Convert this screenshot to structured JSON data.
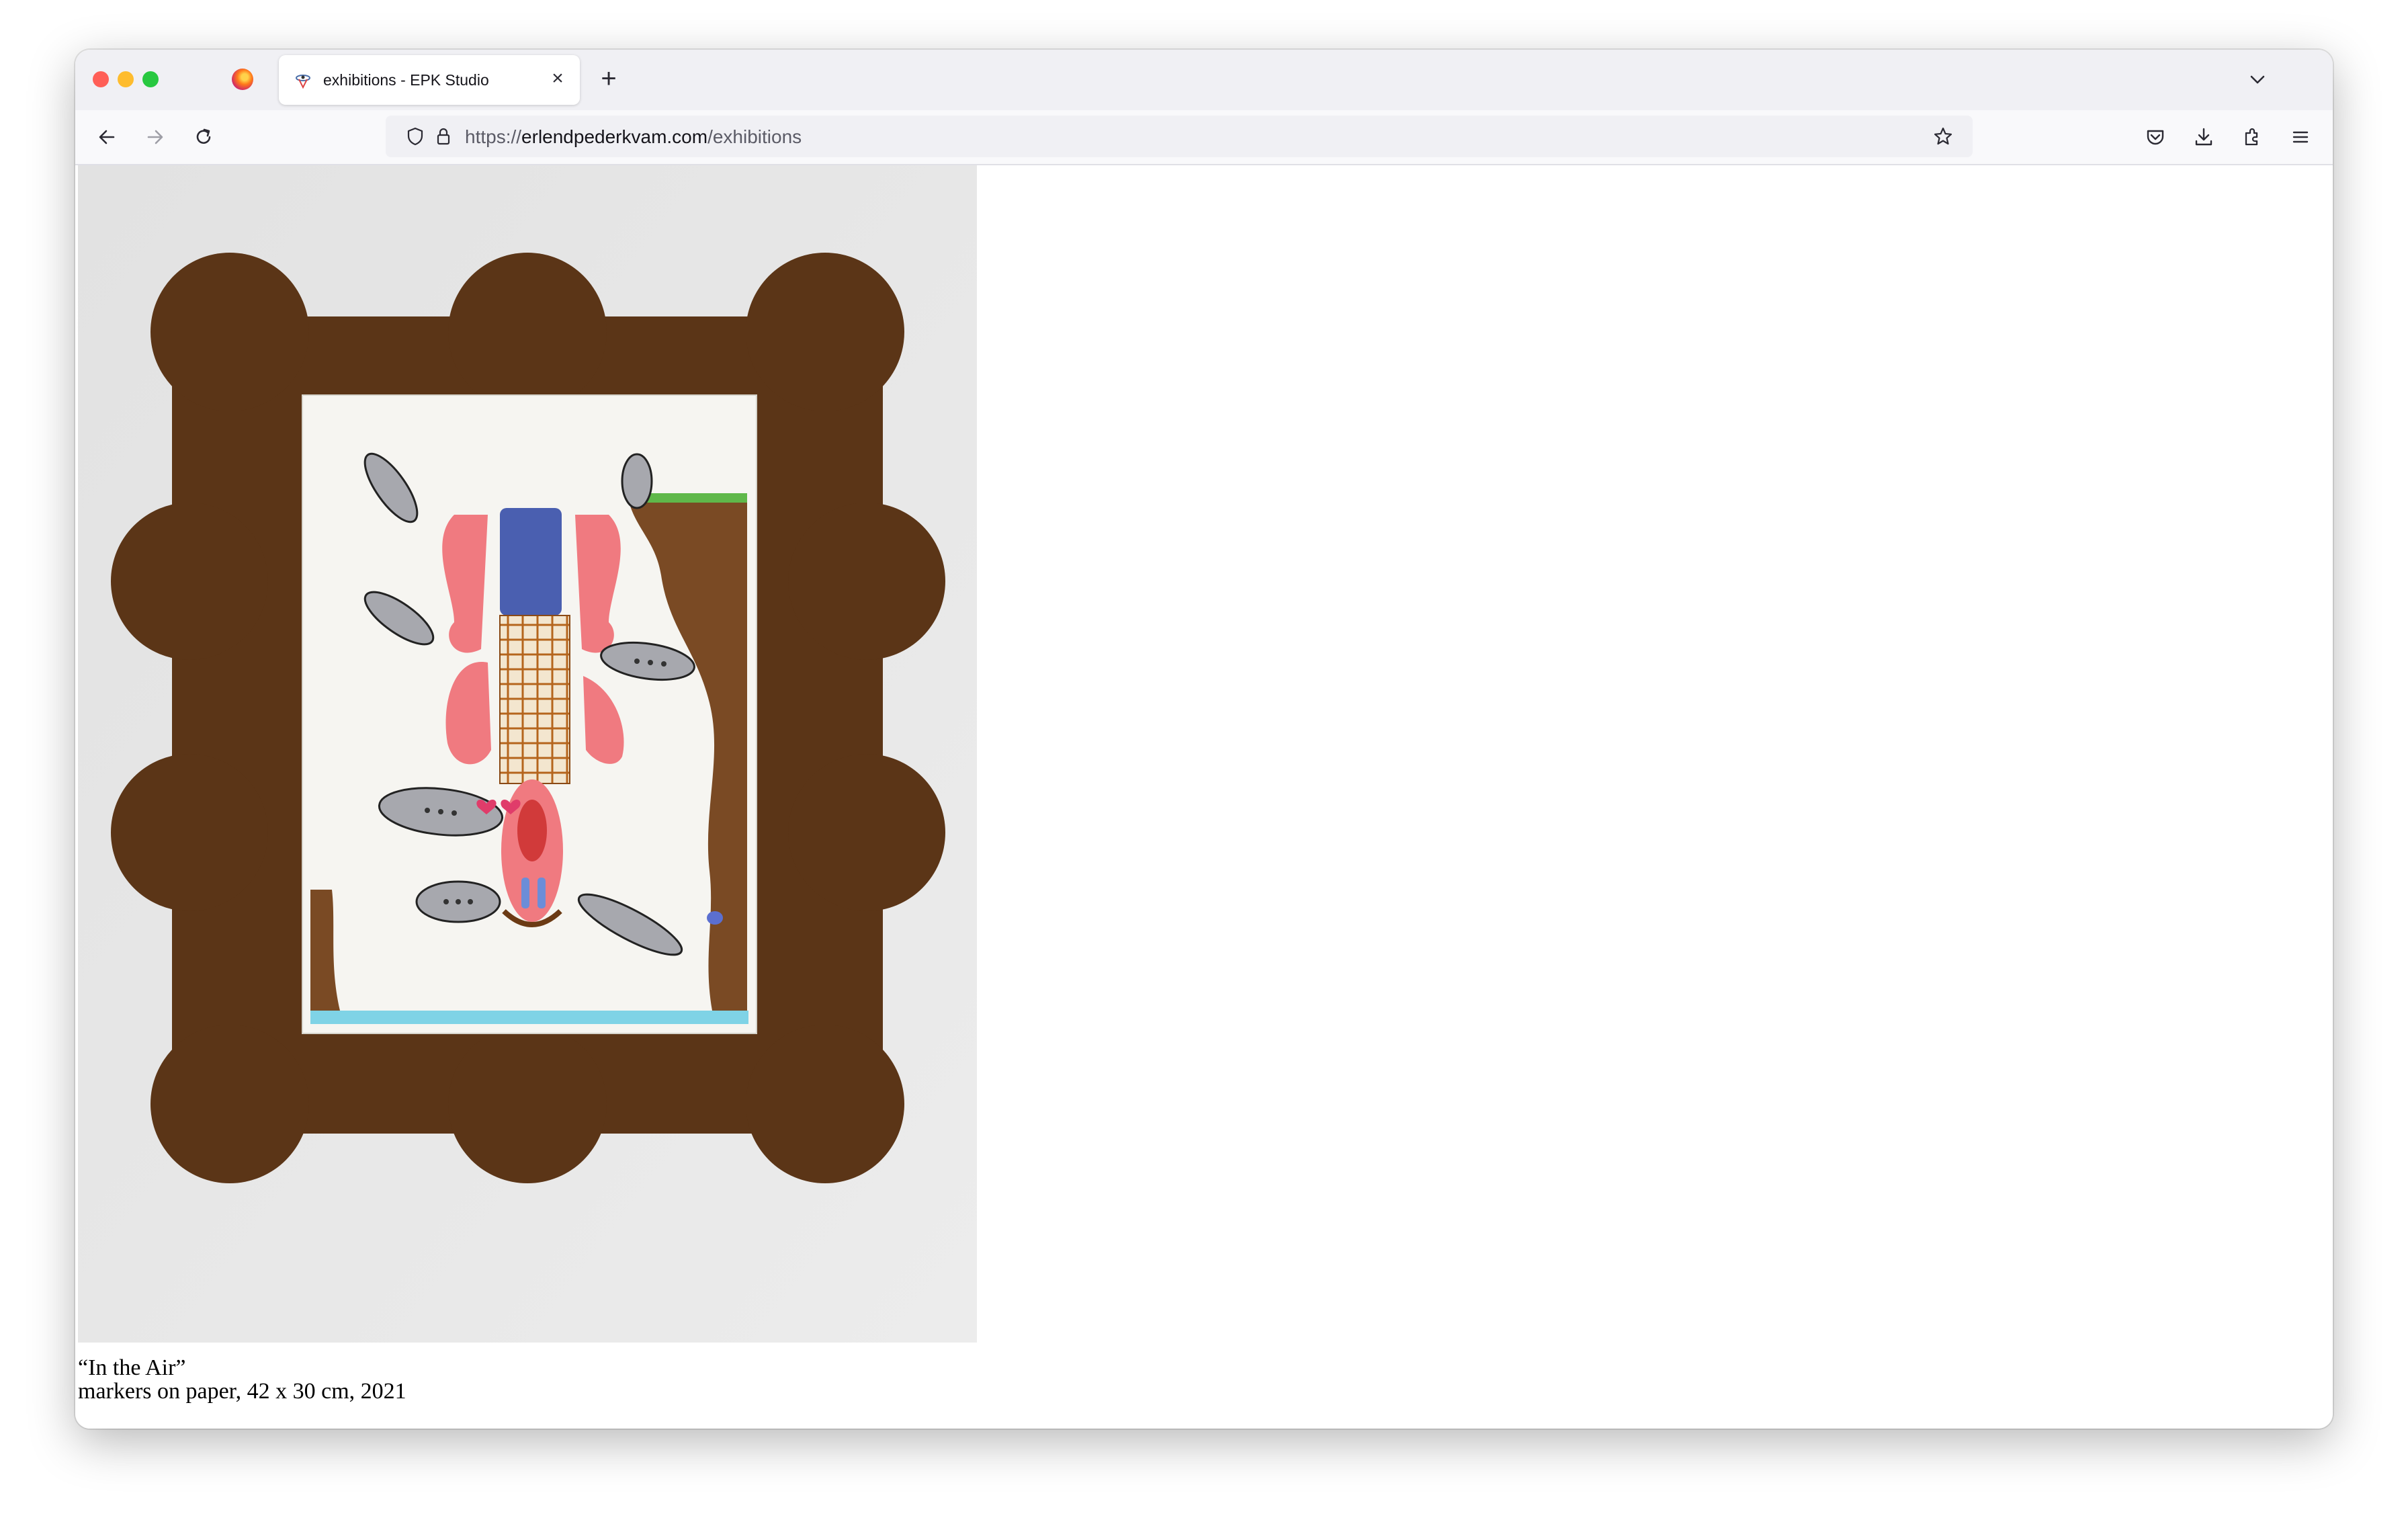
{
  "browser": {
    "tab": {
      "title": "exhibitions - EPK Studio",
      "close_glyph": "×"
    },
    "new_tab_glyph": "+",
    "address_bar": {
      "scheme": "https://",
      "host": "erlendpederkvam.com",
      "path": "/exhibitions"
    },
    "icons": [
      "firefox-logo-icon",
      "back-arrow-icon",
      "forward-arrow-icon",
      "reload-icon",
      "tracking-shield-icon",
      "lock-icon",
      "bookmark-star-icon",
      "pocket-icon",
      "downloads-icon",
      "extensions-icon",
      "menu-icon",
      "tab-list-chevron-icon"
    ]
  },
  "page": {
    "artwork": {
      "title": "“In the Air”",
      "details": "markers on paper, 42 x 30 cm, 2021"
    }
  },
  "colors": {
    "frame_brown": "#5b3517",
    "paper": "#f6f5f1",
    "wall": "#e6e6e6",
    "window_chrome": "#f0f0f4"
  }
}
